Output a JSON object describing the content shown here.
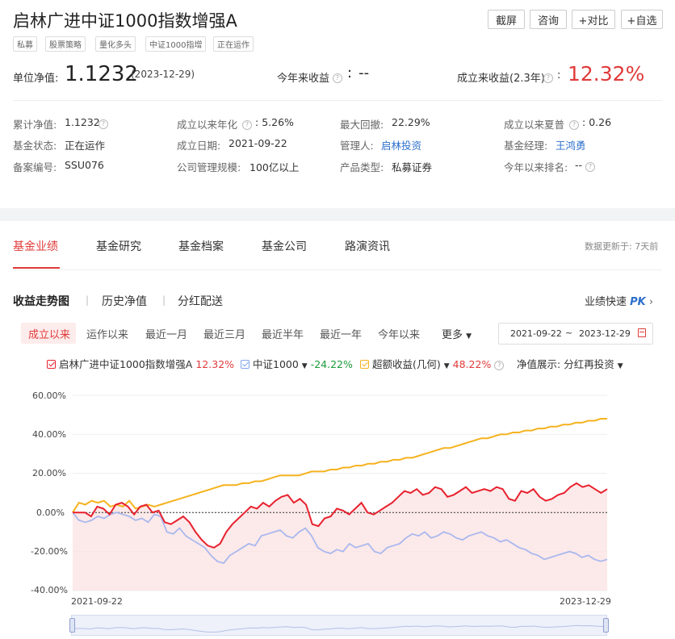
{
  "header": {
    "title": "启林广进中证1000指数增强A",
    "buttons": [
      "截屏",
      "咨询",
      "+对比",
      "+自选"
    ],
    "tags": [
      "私募",
      "股票策略",
      "量化多头",
      "中证1000指增",
      "正在运作"
    ]
  },
  "nav_row": {
    "unit_label": "单位净值:",
    "unit_value": "1.1232",
    "unit_date": "(2023-12-29)",
    "ytd_label": "今年来收益",
    "ytd_value": "--",
    "since_label": "成立来收益(2.3年)",
    "since_value": "12.32%"
  },
  "info": {
    "cum_label": "累计净值:",
    "cum_value": "1.1232",
    "annual_label": "成立以来年化",
    "annual_value": "5.26%",
    "dd_label": "最大回撤:",
    "dd_value": "22.29%",
    "sharpe_label": "成立以来夏普",
    "sharpe_value": "0.26",
    "status_label": "基金状态:",
    "status_value": "正在运作",
    "date_label": "成立日期:",
    "date_value": "2021-09-22",
    "mgr_label": "管理人:",
    "mgr_value": "启林投资",
    "pm_label": "基金经理:",
    "pm_value": "王鸿勇",
    "reg_label": "备案编号:",
    "reg_value": "SSU076",
    "scale_label": "公司管理规模:",
    "scale_value": "100亿以上",
    "type_label": "产品类型:",
    "type_value": "私募证券",
    "rank_label": "今年以来排名:",
    "rank_value": "--"
  },
  "tabs": {
    "items": [
      "基金业绩",
      "基金研究",
      "基金档案",
      "基金公司",
      "路演资讯"
    ],
    "update": "数据更新于: 7天前"
  },
  "subtabs": {
    "items": [
      "收益走势图",
      "历史净值",
      "分红配送"
    ],
    "pk_label": "业绩快速",
    "pk_logo": "PK"
  },
  "ranges": {
    "items": [
      "成立以来",
      "运作以来",
      "最近一月",
      "最近三月",
      "最近半年",
      "最近一年",
      "今年以来"
    ],
    "more": "更多",
    "start": "2021-09-22",
    "tilde": "~",
    "end": "2023-12-29"
  },
  "legend": {
    "fund": "启林广进中证1000指数增强A",
    "fund_val": "12.32%",
    "index": "中证1000",
    "index_val": "-24.22%",
    "excess": "超额收益(几何)",
    "excess_val": "48.22%",
    "display_label": "净值展示:",
    "display_value": "分红再投资"
  },
  "colors": {
    "fund": "#e8212e",
    "index": "#a9b8ee",
    "excess": "#f5b21e",
    "accent": "#e03a3a",
    "link": "#2d6fcc"
  },
  "chart_data": {
    "type": "line",
    "x_start": "2021-09-22",
    "x_end": "2023-12-29",
    "xticks": [
      "2021-09-22",
      "2023-12-29"
    ],
    "yticks": [
      "60.00%",
      "40.00%",
      "20.00%",
      "0.00%",
      "-20.00%",
      "-40.00%"
    ],
    "ylim": [
      -40,
      60
    ],
    "series": [
      {
        "name": "启林广进中证1000指数增强A",
        "values": [
          0,
          0,
          0,
          -2,
          3,
          2,
          -1,
          4,
          5,
          3,
          -1,
          3,
          4,
          0,
          1,
          -5,
          -6,
          -4,
          -2,
          -5,
          -10,
          -14,
          -17,
          -18,
          -16,
          -10,
          -6,
          -3,
          0,
          3,
          2,
          5,
          3,
          6,
          8,
          9,
          5,
          7,
          4,
          -6,
          -7,
          -3,
          -2,
          2,
          1,
          -1,
          2,
          5,
          0,
          -1,
          1,
          3,
          5,
          8,
          11,
          10,
          12,
          9,
          10,
          13,
          12,
          8,
          9,
          11,
          13,
          10,
          11,
          12,
          11,
          13,
          12,
          7,
          6,
          11,
          10,
          12,
          8,
          6,
          7,
          9,
          10,
          13,
          15,
          13,
          14,
          12,
          10,
          12
        ]
      },
      {
        "name": "中证1000",
        "values": [
          0,
          -4,
          -5,
          -4,
          -2,
          -3,
          -1,
          0,
          -1,
          -2,
          -4,
          -3,
          -5,
          -1,
          -2,
          -10,
          -11,
          -8,
          -12,
          -14,
          -16,
          -18,
          -22,
          -25,
          -26,
          -22,
          -20,
          -18,
          -16,
          -17,
          -12,
          -11,
          -10,
          -9,
          -12,
          -13,
          -10,
          -8,
          -12,
          -18,
          -20,
          -21,
          -19,
          -20,
          -16,
          -18,
          -17,
          -16,
          -20,
          -21,
          -18,
          -17,
          -16,
          -13,
          -11,
          -12,
          -10,
          -13,
          -12,
          -10,
          -11,
          -13,
          -14,
          -12,
          -11,
          -10,
          -12,
          -13,
          -15,
          -14,
          -16,
          -18,
          -19,
          -21,
          -22,
          -24,
          -23,
          -22,
          -21,
          -20,
          -21,
          -23,
          -22,
          -24,
          -25,
          -24
        ]
      },
      {
        "name": "超额收益(几何)",
        "values": [
          0,
          5,
          4,
          6,
          5,
          6,
          3,
          4,
          3,
          6,
          2,
          3,
          4,
          3,
          4,
          5,
          6,
          7,
          8,
          9,
          10,
          11,
          12,
          13,
          14,
          14,
          14,
          15,
          15,
          16,
          16,
          17,
          18,
          19,
          19,
          19,
          19,
          20,
          21,
          21,
          21,
          22,
          22,
          23,
          23,
          24,
          24,
          25,
          25,
          26,
          26,
          27,
          27,
          28,
          28,
          29,
          30,
          31,
          32,
          33,
          33,
          34,
          35,
          36,
          37,
          38,
          38,
          39,
          40,
          40,
          41,
          41,
          42,
          42,
          43,
          43,
          44,
          44,
          45,
          45,
          46,
          46,
          47,
          47,
          48,
          48
        ]
      }
    ]
  }
}
